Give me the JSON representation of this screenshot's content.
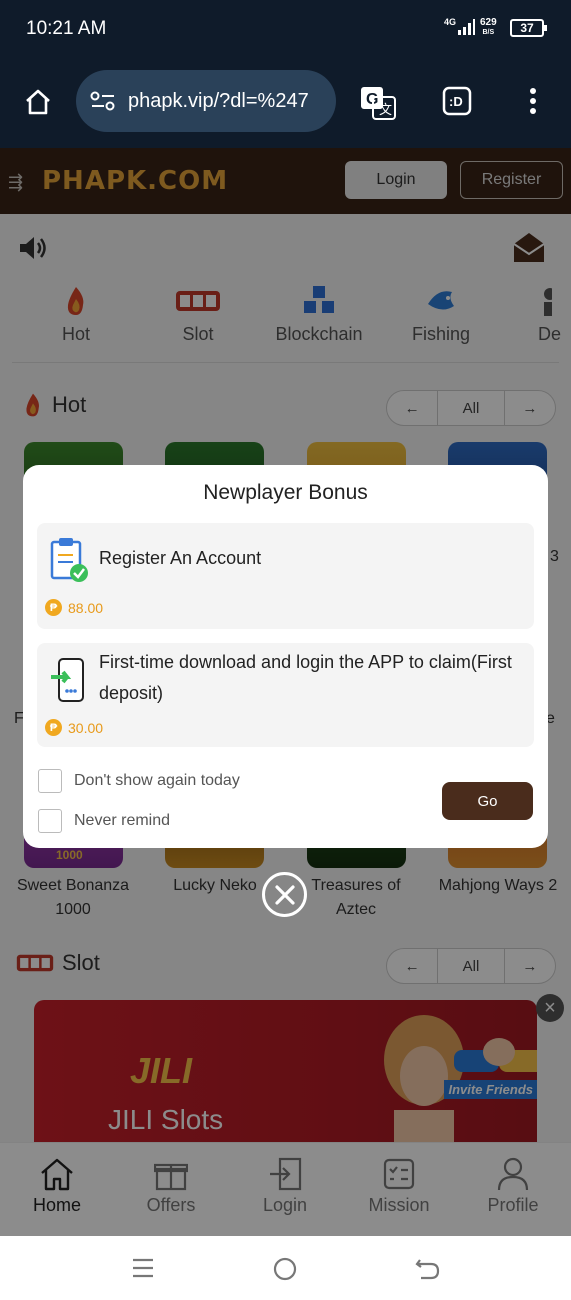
{
  "status_bar": {
    "time": "10:21 AM",
    "network": "4G",
    "speed_value": "629",
    "speed_unit": "B/S",
    "battery": "37"
  },
  "browser": {
    "url": "phapk.vip/?dl=%247"
  },
  "site": {
    "logo": "PHAPK.COM",
    "login_label": "Login",
    "register_label": "Register",
    "categories": [
      {
        "label": "Hot",
        "icon": "fire-icon"
      },
      {
        "label": "Slot",
        "icon": "slot-machine-icon"
      },
      {
        "label": "Blockchain",
        "icon": "blockchain-cubes-icon"
      },
      {
        "label": "Fishing",
        "icon": "shark-icon"
      },
      {
        "label": "De",
        "icon": "dealer-icon"
      }
    ],
    "hot_section": {
      "title": "Hot",
      "all_label": "All",
      "prev": "←",
      "next": "→"
    },
    "hot_games": [
      {
        "name": "Sweet Bonanza 1000",
        "badge": "1000"
      },
      {
        "name": "Lucky Neko"
      },
      {
        "name": "Treasures of Aztec"
      },
      {
        "name": "Mahjong Ways 2"
      }
    ],
    "partial_labels": {
      "left": "F",
      "right": "e",
      "right_top": "3"
    },
    "slot_section": {
      "title": "Slot",
      "all_label": "All",
      "prev": "←",
      "next": "→"
    },
    "banner": {
      "brand": "JILI",
      "title": "JILI Slots",
      "invite": "Invite Friends",
      "close": "×"
    },
    "tabs": [
      {
        "label": "Home",
        "icon": "home-icon",
        "active": true
      },
      {
        "label": "Offers",
        "icon": "gift-icon"
      },
      {
        "label": "Login",
        "icon": "login-icon"
      },
      {
        "label": "Mission",
        "icon": "mission-icon"
      },
      {
        "label": "Profile",
        "icon": "profile-icon"
      }
    ]
  },
  "modal": {
    "title": "Newplayer Bonus",
    "tasks": [
      {
        "label": "Register An Account",
        "reward": "88.00",
        "icon": "clipboard-check-icon"
      },
      {
        "label": "First-time download and login the APP to claim(First deposit)",
        "reward": "30.00",
        "icon": "phone-download-icon"
      }
    ],
    "coin_symbol": "₱",
    "checkbox_today": "Don't show again today",
    "checkbox_never": "Never remind",
    "go_label": "Go"
  },
  "colors": {
    "header_brown": "#3a2416",
    "go_button": "#4a2c1c",
    "reward_orange": "#e89a1a",
    "browser_bg": "#0f1b2a"
  }
}
